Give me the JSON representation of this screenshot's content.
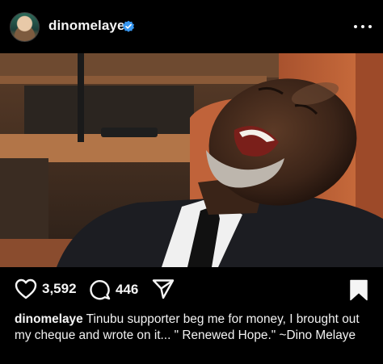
{
  "post": {
    "username": "dinomelaye",
    "verified": true,
    "avatar": "profile-photo",
    "more_menu": "more-options-icon"
  },
  "actions": {
    "like_icon": "heart-icon",
    "like_count": "3,592",
    "comment_icon": "comment-bubble-icon",
    "comment_count": "446",
    "share_icon": "paper-plane-icon",
    "save_icon": "bookmark-icon"
  },
  "caption": {
    "username": "dinomelaye",
    "text": " Tinubu supporter beg me for money, I brought out my cheque and wrote on it... \" Renewed Hope.\" ~Dino Melaye"
  },
  "colors": {
    "background": "#000000",
    "text": "#f5f5f5",
    "verified": "#3897f0"
  }
}
